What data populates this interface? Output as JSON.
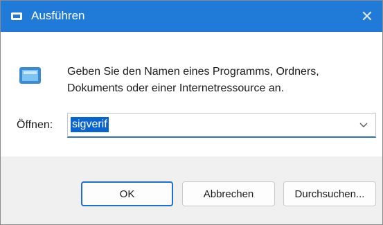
{
  "window": {
    "title": "Ausführen",
    "close_label": "✕"
  },
  "dialog": {
    "message_line1": "Geben Sie den Namen eines Programms, Ordners,",
    "message_line2": "Dokuments oder einer Internetressource an.",
    "open_label": "Öffnen:",
    "input_value": "sigverif"
  },
  "buttons": {
    "ok": "OK",
    "cancel": "Abbrechen",
    "browse": "Durchsuchen..."
  },
  "colors": {
    "titlebar": "#1f7ad8",
    "accent": "#0a64d0"
  },
  "icons": {
    "title": "run-dialog-icon",
    "message": "run-dialog-icon",
    "dropdown": "chevron-down-icon",
    "close": "close-icon"
  }
}
